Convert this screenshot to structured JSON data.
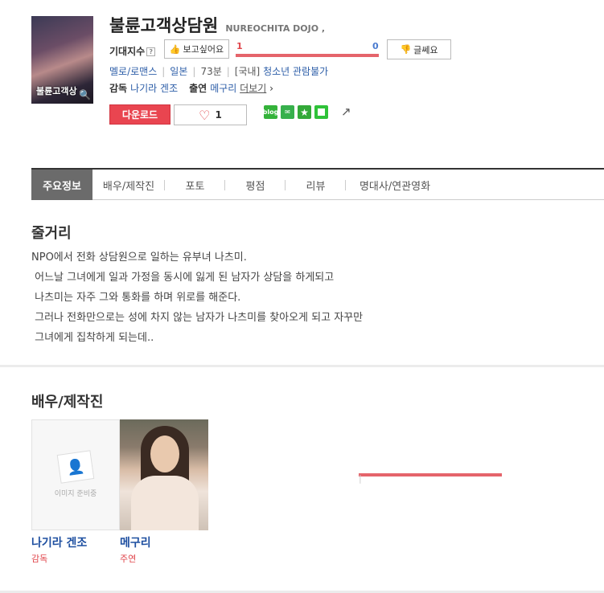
{
  "movie": {
    "poster_text": "불륜고객상",
    "title": "불륜고객상담원",
    "original_title": "NUREOCHITA DOJO ,",
    "expectation_label": "기대지수",
    "help_icon_text": "?",
    "want_label": "보고싶어요",
    "not_label": "글쎄요",
    "want_count": "1",
    "not_count": "0",
    "want_ratio": 1.0,
    "genre": "멜로/로맨스",
    "country": "일본",
    "runtime": "73분",
    "rating_prefix": "[국내]",
    "rating": "청소년 관람불가",
    "director_label": "감독",
    "director": "나기라 겐조",
    "cast_label": "출연",
    "cast": "메구리",
    "more_label": "더보기",
    "more_arrow": "›",
    "download_label": "다운로드",
    "like_count": "1",
    "like_icon": "♡",
    "share_icons": {
      "blog": "blog",
      "star": "★"
    }
  },
  "tabs": [
    {
      "label": "주요정보",
      "active": true
    },
    {
      "label": "배우/제작진"
    },
    {
      "label": "포토"
    },
    {
      "label": "평점"
    },
    {
      "label": "리뷰"
    },
    {
      "label": "명대사/연관영화"
    }
  ],
  "synopsis": {
    "title": "줄거리",
    "text": "NPO에서 전화 상담원으로 일하는 유부녀 나츠미.\n 어느날 그녀에게 일과 가정을 동시에 잃게 된 남자가 상담을 하게되고\n 나츠미는 자주 그와 통화를 하며 위로를 해준다.\n 그러나 전화만으로는 성에 차지 않는 남자가 나츠미를 찾아오게 되고 자꾸만\n 그녀에게 집착하게 되는데.."
  },
  "crew": {
    "title": "배우/제작진",
    "no_image_text": "이미지 준비중",
    "people": [
      {
        "name": "나기라 겐조",
        "role": "감독"
      },
      {
        "name": "메구리",
        "role": "주연"
      }
    ]
  }
}
